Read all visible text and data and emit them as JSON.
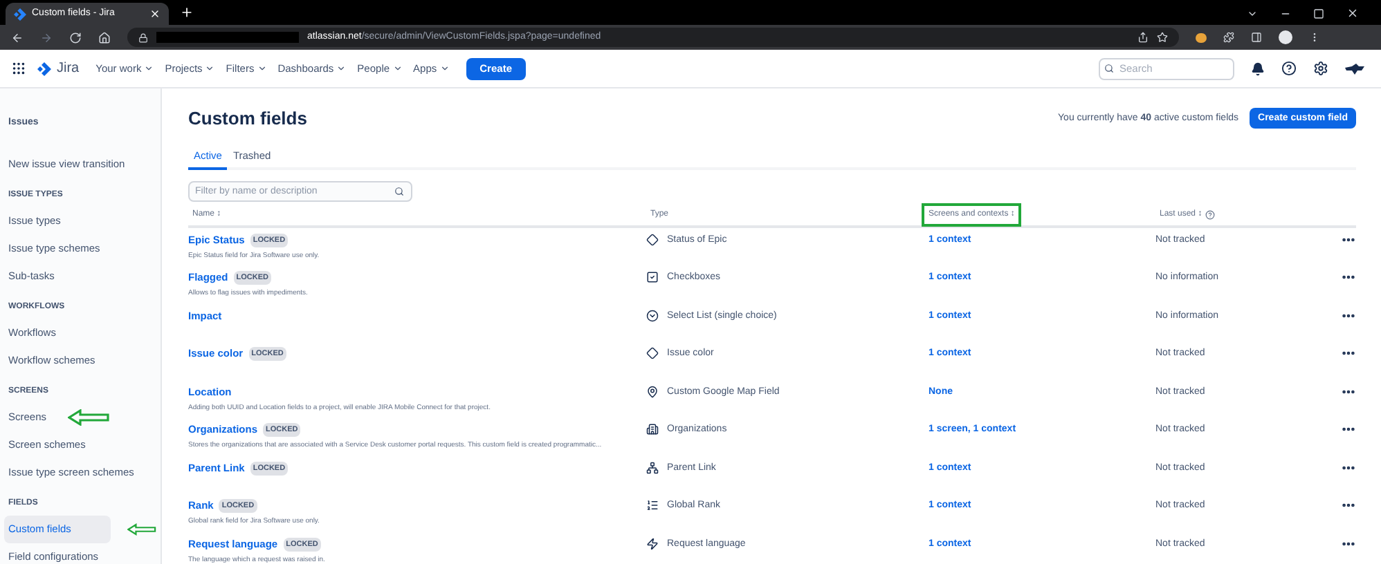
{
  "browser": {
    "tab_title": "Custom fields - Jira",
    "url_host": "atlassian.net",
    "url_path": "/secure/admin/ViewCustomFields.jspa?page=undefined"
  },
  "nav": {
    "items": [
      {
        "label": "Your work"
      },
      {
        "label": "Projects"
      },
      {
        "label": "Filters"
      },
      {
        "label": "Dashboards"
      },
      {
        "label": "People"
      },
      {
        "label": "Apps"
      }
    ],
    "product": "Jira",
    "create": "Create",
    "search_placeholder": "Search"
  },
  "sidebar": {
    "items": [
      {
        "kind": "label",
        "label": "Issues"
      },
      {
        "kind": "link",
        "label": "New issue view transition",
        "selected": false,
        "annotated": false
      },
      {
        "kind": "heading",
        "label": "ISSUE TYPES"
      },
      {
        "kind": "link",
        "label": "Issue types",
        "selected": false,
        "annotated": false
      },
      {
        "kind": "link",
        "label": "Issue type schemes",
        "selected": false,
        "annotated": false
      },
      {
        "kind": "link",
        "label": "Sub-tasks",
        "selected": false,
        "annotated": false
      },
      {
        "kind": "heading",
        "label": "WORKFLOWS"
      },
      {
        "kind": "link",
        "label": "Workflows",
        "selected": false,
        "annotated": false
      },
      {
        "kind": "link",
        "label": "Workflow schemes",
        "selected": false,
        "annotated": false
      },
      {
        "kind": "heading",
        "label": "SCREENS"
      },
      {
        "kind": "link",
        "label": "Screens",
        "selected": false,
        "annotated": true
      },
      {
        "kind": "link",
        "label": "Screen schemes",
        "selected": false,
        "annotated": false
      },
      {
        "kind": "link",
        "label": "Issue type screen schemes",
        "selected": false,
        "annotated": false
      },
      {
        "kind": "heading",
        "label": "FIELDS"
      },
      {
        "kind": "link",
        "label": "Custom fields",
        "selected": true,
        "annotated": true
      },
      {
        "kind": "link",
        "label": "Field configurations",
        "selected": false,
        "annotated": false
      }
    ]
  },
  "page": {
    "title": "Custom fields",
    "summary": "You currently have **40** active custom fields",
    "create_button": "Create custom field",
    "tabs": [
      {
        "label": "Active",
        "selected": true
      },
      {
        "label": "Trashed",
        "selected": false
      }
    ],
    "filter_placeholder": "Filter by name or description",
    "columns": [
      {
        "label": "Name",
        "sort": "↕",
        "highlighted": false,
        "help": false
      },
      {
        "label": "Type",
        "highlighted": false,
        "help": false
      },
      {
        "label": "Screens and contexts",
        "sort": "↕",
        "highlighted": true,
        "help": false
      },
      {
        "label": "Last used",
        "sort": "↕",
        "highlighted": false,
        "help": true
      }
    ],
    "rows": [
      {
        "name": "Epic Status",
        "badge": "LOCKED",
        "description": "Epic Status field for Jira Software use only.",
        "type": "Status of Epic",
        "kind": "diamond",
        "screens": "1 context",
        "last_used": "Not tracked"
      },
      {
        "name": "Flagged",
        "badge": "LOCKED",
        "description": "Allows to flag issues with impediments.",
        "type": "Checkboxes",
        "kind": "checkbox",
        "screens": "1 context",
        "last_used": "No information"
      },
      {
        "name": "Impact",
        "type": "Select List (single choice)",
        "kind": "select",
        "screens": "1 context",
        "last_used": "No information"
      },
      {
        "name": "Issue color",
        "badge": "LOCKED",
        "type": "Issue color",
        "kind": "diamond",
        "screens": "1 context",
        "last_used": "Not tracked"
      },
      {
        "name": "Location",
        "description": "Adding both UUID and Location fields to a project, will enable JIRA Mobile Connect for that project.",
        "type": "Custom Google Map Field",
        "kind": "pin",
        "screens": "None",
        "last_used": "Not tracked"
      },
      {
        "name": "Organizations",
        "badge": "LOCKED",
        "description": "Stores the organizations that are associated with a Service Desk customer portal requests. This custom field is created programmatic...",
        "type": "Organizations",
        "kind": "org",
        "screens": "1 screen, 1 context",
        "last_used": "Not tracked"
      },
      {
        "name": "Parent Link",
        "badge": "LOCKED",
        "type": "Parent Link",
        "kind": "hierarchy",
        "screens": "1 context",
        "last_used": "Not tracked"
      },
      {
        "name": "Rank",
        "badge": "LOCKED",
        "description": "Global rank field for Jira Software use only.",
        "type": "Global Rank",
        "kind": "list",
        "screens": "1 context",
        "last_used": "Not tracked"
      },
      {
        "name": "Request language",
        "badge": "LOCKED",
        "description": "The language which a request was raised in.",
        "type": "Request language",
        "kind": "bolt",
        "screens": "1 context",
        "last_used": "Not tracked"
      }
    ]
  }
}
